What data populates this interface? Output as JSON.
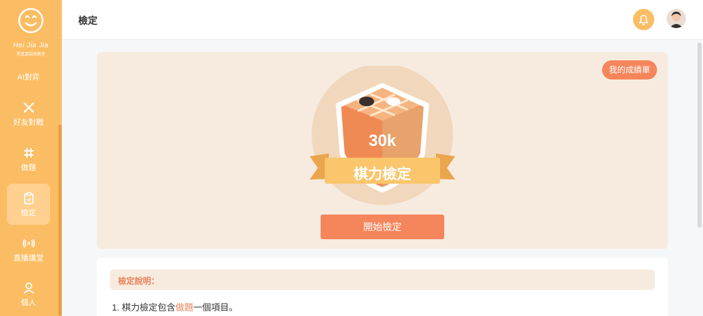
{
  "sidebar": {
    "brand": "Hei Jia Jia",
    "brand_sub": "黑嘉嘉圍棋教室",
    "items": [
      {
        "label": "AI對弈",
        "icon": "robot-icon"
      },
      {
        "label": "好友對戰",
        "icon": "crossed-swords-icon"
      },
      {
        "label": "做題",
        "icon": "hash-icon"
      },
      {
        "label": "檢定",
        "icon": "clipboard-icon"
      },
      {
        "label": "直播講堂",
        "icon": "broadcast-icon"
      },
      {
        "label": "個人",
        "icon": "person-icon"
      }
    ],
    "active_index": 3
  },
  "header": {
    "title": "檢定",
    "bell_icon": "bell-icon",
    "avatar": "avatar"
  },
  "exam": {
    "report_button": "我的成績單",
    "level": "30k",
    "banner_text": "棋力檢定",
    "start_button": "開始檢定"
  },
  "description": {
    "title": "檢定說明：",
    "line_prefix": "1. 棋力檢定包含",
    "line_link": "做題",
    "line_suffix": "一個項目。"
  },
  "colors": {
    "sidebar": "#fbbd63",
    "accent": "#f5855b",
    "card_bg": "#f7ebdf"
  }
}
